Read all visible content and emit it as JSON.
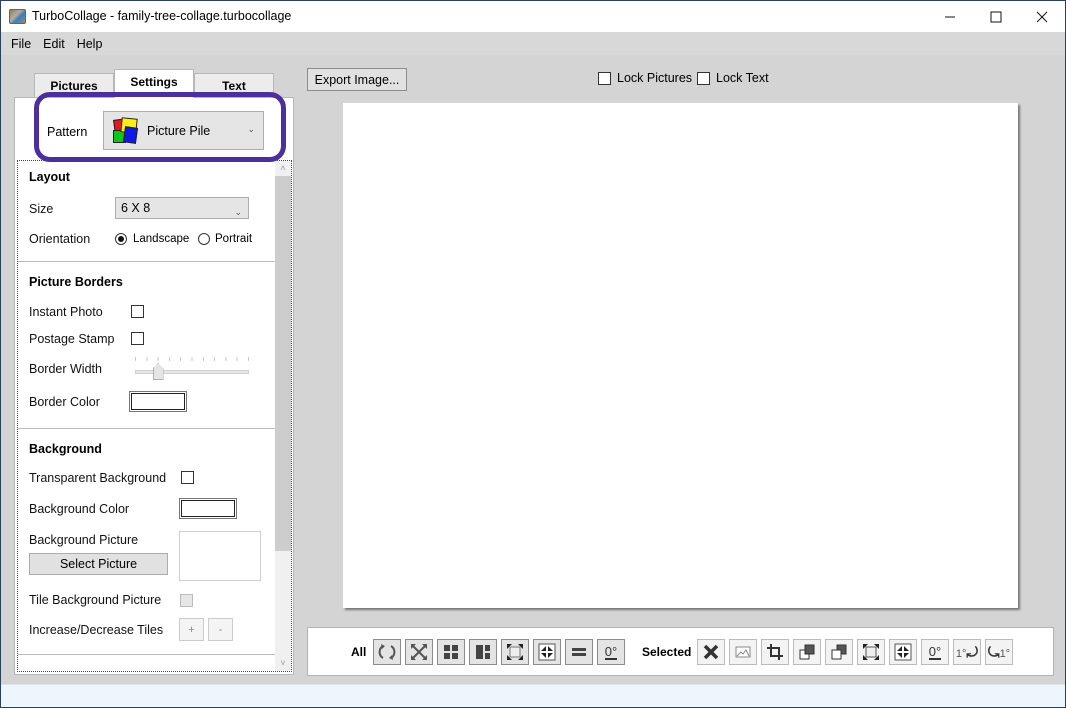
{
  "window": {
    "title": "TurboCollage - family-tree-collage.turbocollage",
    "controls": {
      "minimize": "—",
      "maximize": "☐",
      "close": "✕"
    }
  },
  "menu": [
    "File",
    "Edit",
    "Help"
  ],
  "tabs": [
    {
      "label": "Pictures",
      "active": false
    },
    {
      "label": "Settings",
      "active": true
    },
    {
      "label": "Text",
      "active": false
    }
  ],
  "settings": {
    "pattern": {
      "label": "Pattern",
      "value": "Picture Pile",
      "icon": "picture-pile-icon"
    },
    "layout": {
      "title": "Layout",
      "size_label": "Size",
      "size_value": "6 X 8",
      "orientation_label": "Orientation",
      "orientation_options": [
        "Landscape",
        "Portrait"
      ],
      "orientation_selected": "Landscape"
    },
    "picture_borders": {
      "title": "Picture Borders",
      "instant_photo_label": "Instant Photo",
      "instant_photo_checked": false,
      "postage_stamp_label": "Postage Stamp",
      "postage_stamp_checked": false,
      "border_width_label": "Border Width",
      "border_width_fraction": 0.17,
      "border_color_label": "Border Color",
      "border_color": "#ffffff"
    },
    "background": {
      "title": "Background",
      "transparent_label": "Transparent Background",
      "transparent_checked": false,
      "color_label": "Background Color",
      "color": "#ffffff",
      "picture_label": "Background Picture",
      "select_picture_button": "Select Picture",
      "tile_label": "Tile Background Picture",
      "tile_checked": false,
      "tiles_label": "Increase/Decrease Tiles",
      "increase": "+",
      "decrease": "-"
    }
  },
  "toolbar": {
    "export_button": "Export Image...",
    "lock_pictures_label": "Lock Pictures",
    "lock_pictures_checked": false,
    "lock_text_label": "Lock Text",
    "lock_text_checked": false
  },
  "bottom_bar": {
    "all_label": "All",
    "all_buttons": [
      "shuffle-icon",
      "fit-all-icon",
      "grid-icon",
      "mosaic-icon",
      "expand-icon",
      "shrink-icon",
      "align-icon",
      "rotate-zero-icon"
    ],
    "selected_label": "Selected",
    "selected_buttons": [
      "delete-icon",
      "replace-picture-icon",
      "crop-icon",
      "send-backward-icon",
      "bring-forward-icon",
      "expand-icon",
      "shrink-icon",
      "rotate-zero-icon",
      "rotate-left-icon",
      "rotate-right-icon"
    ],
    "rotate_zero_text": "0°",
    "rotate_step_text": "1°"
  },
  "accent": {
    "highlight_ring": "#4c2f9e"
  }
}
